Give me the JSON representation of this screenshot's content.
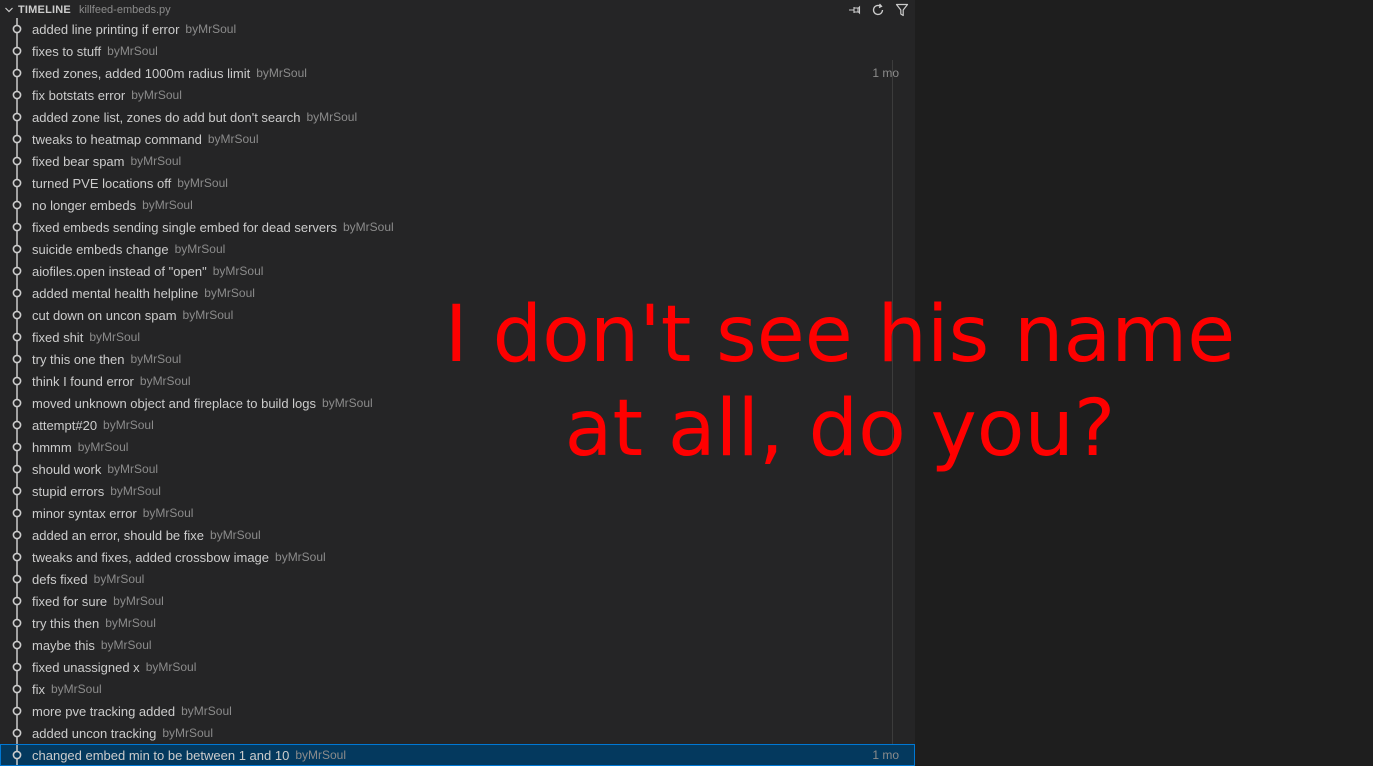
{
  "header": {
    "title": "TIMELINE",
    "file": "killfeed-embeds.py",
    "actions": [
      {
        "name": "pin-icon"
      },
      {
        "name": "refresh-icon"
      },
      {
        "name": "filter-icon"
      }
    ]
  },
  "commits": [
    {
      "message": "added line printing if error",
      "author": "byMrSoul",
      "time": ""
    },
    {
      "message": "fixes to stuff",
      "author": "byMrSoul",
      "time": ""
    },
    {
      "message": "fixed zones, added 1000m radius limit",
      "author": "byMrSoul",
      "time": "1 mo"
    },
    {
      "message": "fix botstats error",
      "author": "byMrSoul",
      "time": ""
    },
    {
      "message": "added zone list, zones do add but don't search",
      "author": "byMrSoul",
      "time": ""
    },
    {
      "message": "tweaks to heatmap command",
      "author": "byMrSoul",
      "time": ""
    },
    {
      "message": "fixed bear spam",
      "author": "byMrSoul",
      "time": ""
    },
    {
      "message": "turned PVE locations off",
      "author": "byMrSoul",
      "time": ""
    },
    {
      "message": "no longer embeds",
      "author": "byMrSoul",
      "time": ""
    },
    {
      "message": "fixed embeds sending single embed for dead servers",
      "author": "byMrSoul",
      "time": ""
    },
    {
      "message": "suicide embeds change",
      "author": "byMrSoul",
      "time": ""
    },
    {
      "message": "aiofiles.open instead of \"open\"",
      "author": "byMrSoul",
      "time": ""
    },
    {
      "message": "added mental health helpline",
      "author": "byMrSoul",
      "time": ""
    },
    {
      "message": "cut down on uncon spam",
      "author": "byMrSoul",
      "time": ""
    },
    {
      "message": "fixed shit",
      "author": "byMrSoul",
      "time": ""
    },
    {
      "message": "try this one then",
      "author": "byMrSoul",
      "time": ""
    },
    {
      "message": "think I found error",
      "author": "byMrSoul",
      "time": ""
    },
    {
      "message": "moved unknown object and fireplace to build logs",
      "author": "byMrSoul",
      "time": ""
    },
    {
      "message": "attempt#20",
      "author": "byMrSoul",
      "time": ""
    },
    {
      "message": "hmmm",
      "author": "byMrSoul",
      "time": ""
    },
    {
      "message": "should work",
      "author": "byMrSoul",
      "time": ""
    },
    {
      "message": "stupid errors",
      "author": "byMrSoul",
      "time": ""
    },
    {
      "message": "minor syntax error",
      "author": "byMrSoul",
      "time": ""
    },
    {
      "message": "added an error, should be fixe",
      "author": "byMrSoul",
      "time": ""
    },
    {
      "message": "tweaks and fixes, added crossbow image",
      "author": "byMrSoul",
      "time": ""
    },
    {
      "message": "defs fixed",
      "author": "byMrSoul",
      "time": ""
    },
    {
      "message": "fixed for sure",
      "author": "byMrSoul",
      "time": ""
    },
    {
      "message": "try this then",
      "author": "byMrSoul",
      "time": ""
    },
    {
      "message": "maybe this",
      "author": "byMrSoul",
      "time": ""
    },
    {
      "message": "fixed unassigned x",
      "author": "byMrSoul",
      "time": ""
    },
    {
      "message": "fix",
      "author": "byMrSoul",
      "time": ""
    },
    {
      "message": "more pve tracking added",
      "author": "byMrSoul",
      "time": ""
    },
    {
      "message": "added uncon tracking",
      "author": "byMrSoul",
      "time": ""
    },
    {
      "message": "changed embed min to be between 1 and 10",
      "author": "byMrSoul",
      "time": "1 mo",
      "selected": true
    }
  ],
  "overlay": {
    "line1": "I don't see his name",
    "line2": "at all, do you?",
    "color": "#ff0000"
  },
  "colors": {
    "panel_bg": "#252526",
    "selection_bg": "#04395e",
    "selection_border": "#0078d4",
    "text": "#cccccc",
    "muted": "#8b8b8b"
  }
}
